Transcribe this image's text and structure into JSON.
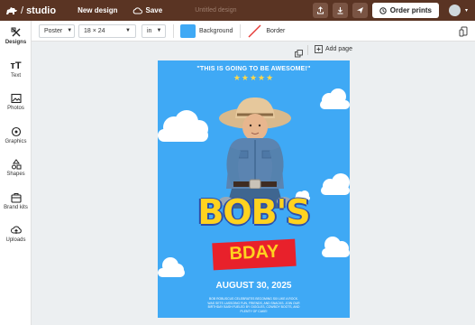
{
  "topbar": {
    "brand": "studio",
    "new_design": "New design",
    "save": "Save",
    "doc_title": "Untitled design",
    "order_prints": "Order prints"
  },
  "toolbar": {
    "format": "Poster",
    "size": "18 × 24",
    "unit": "in",
    "background_label": "Background",
    "border_label": "Border",
    "background_color": "#3fa9f5"
  },
  "sidebar": {
    "items": [
      {
        "label": "Designs",
        "icon": "designs-icon"
      },
      {
        "label": "Text",
        "icon": "text-icon"
      },
      {
        "label": "Photos",
        "icon": "photos-icon"
      },
      {
        "label": "Graphics",
        "icon": "graphics-icon"
      },
      {
        "label": "Shapes",
        "icon": "shapes-icon"
      },
      {
        "label": "Brand kits",
        "icon": "brand-kits-icon"
      },
      {
        "label": "Uploads",
        "icon": "uploads-icon"
      }
    ]
  },
  "canvas": {
    "add_page": "Add page"
  },
  "poster": {
    "tagline": "\"THIS IS GOING TO BE AWESOME!\"",
    "stars": "★★★★★",
    "name": "BOB'S",
    "event": "BDAY",
    "date": "AUGUST 30, 2025",
    "fine_print": "BOB ROBUSCUS CELEBRATES BECOMING SIX LIKE A ROCK. WAS SETS LASSOING FUN, FRIENDS, AND SNACKS. JOIN OUR BIRTHDAY BASH FUELED BY GIGGLES, COWBOY BOOTS, AND PLENTY OF CAKE!"
  }
}
